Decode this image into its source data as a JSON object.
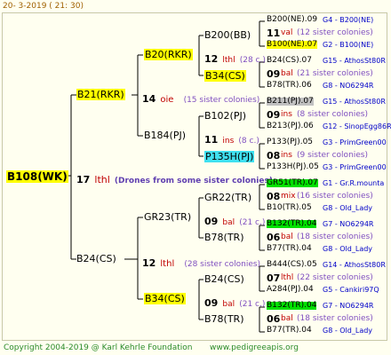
{
  "header": "20-   3-2019  (  21:  30)",
  "footer": {
    "copyright": "Copyright 2004-2019 @ Karl Kehrle Foundation",
    "url": "www.pedigreeapis.org"
  },
  "root": {
    "name": "B108(WK)",
    "num": "17",
    "sp": "lthl",
    "note": "(Drones from some sister colonies)"
  },
  "g1": [
    {
      "name": "B21(RKR)",
      "num": "14",
      "sp": "oie",
      "note": "(15 sister colonies)"
    },
    {
      "name": "B24(CS)",
      "num": "12",
      "sp": "lthl",
      "note": "(28 sister colonies)"
    }
  ],
  "g2": [
    {
      "name": "B20(RKR)",
      "num": "12",
      "sp": "lthl",
      "note": "(28 c.)"
    },
    {
      "name": "B184(PJ)",
      "num": "11",
      "sp": "ins",
      "note": "(8 c.)"
    },
    {
      "name": "GR23(TR)",
      "num": "09",
      "sp": "bal",
      "note": "(21 c.)"
    },
    {
      "name": "B34(CS)",
      "num": "09",
      "sp": "bal",
      "note": "(21 c.)"
    }
  ],
  "g3": [
    {
      "name": "B200(BB)"
    },
    {
      "name": "B34(CS)"
    },
    {
      "name": "B102(PJ)"
    },
    {
      "name": "P135H(PJ)"
    },
    {
      "name": "GR22(TR)"
    },
    {
      "name": "B78(TR)"
    },
    {
      "name": "B24(CS)"
    },
    {
      "name": "B78(TR)"
    }
  ],
  "g4": [
    {
      "top": "B200(NE).09",
      "topref": "G4 - B200(NE)",
      "num": "11",
      "sp": "val",
      "note": "(12 sister colonies)",
      "bot": "B100(NE).07",
      "botref": "G2 - B100(NE)"
    },
    {
      "top": "B24(CS).07",
      "topref": "G15 - AthosSt80R",
      "num": "09",
      "sp": "bal",
      "note": "(21 sister colonies)",
      "bot": "B78(TR).06",
      "botref": "G8 - NO6294R"
    },
    {
      "top": "B211(PJ).07",
      "topref": "G15 - AthosSt80R",
      "num": "09",
      "sp": "ins",
      "note": "(8 sister colonies)",
      "bot": "B213(PJ).06",
      "botref": "G12 - SinopEgg86R"
    },
    {
      "top": "P133(PJ).05",
      "topref": "G3 - PrimGreen00",
      "num": "08",
      "sp": "ins",
      "note": "(9 sister colonies)",
      "bot": "P133H(PJ).05",
      "botref": "G3 - PrimGreen00"
    },
    {
      "top": "GR51(TR).07",
      "topref": "G1 - Gr.R.mounta",
      "num": "08",
      "sp": "mix",
      "note": "(16 sister colonies)",
      "bot": "B10(TR).05",
      "botref": "G8 - Old_Lady"
    },
    {
      "top": "B132(TR).04",
      "topref": "G7 - NO6294R",
      "num": "06",
      "sp": "bal",
      "note": "(18 sister colonies)",
      "bot": "B77(TR).04",
      "botref": "G8 - Old_Lady"
    },
    {
      "top": "B444(CS).05",
      "topref": "G14 - AthosSt80R",
      "num": "07",
      "sp": "lthl",
      "note": "(22 sister colonies)",
      "bot": "A284(PJ).04",
      "botref": "G5 - Cankiri97Q"
    },
    {
      "top": "B132(TR).04",
      "topref": "G7 - NO6294R",
      "num": "06",
      "sp": "bal",
      "note": "(18 sister colonies)",
      "bot": "B77(TR).04",
      "botref": "G8 - Old_Lady"
    }
  ]
}
